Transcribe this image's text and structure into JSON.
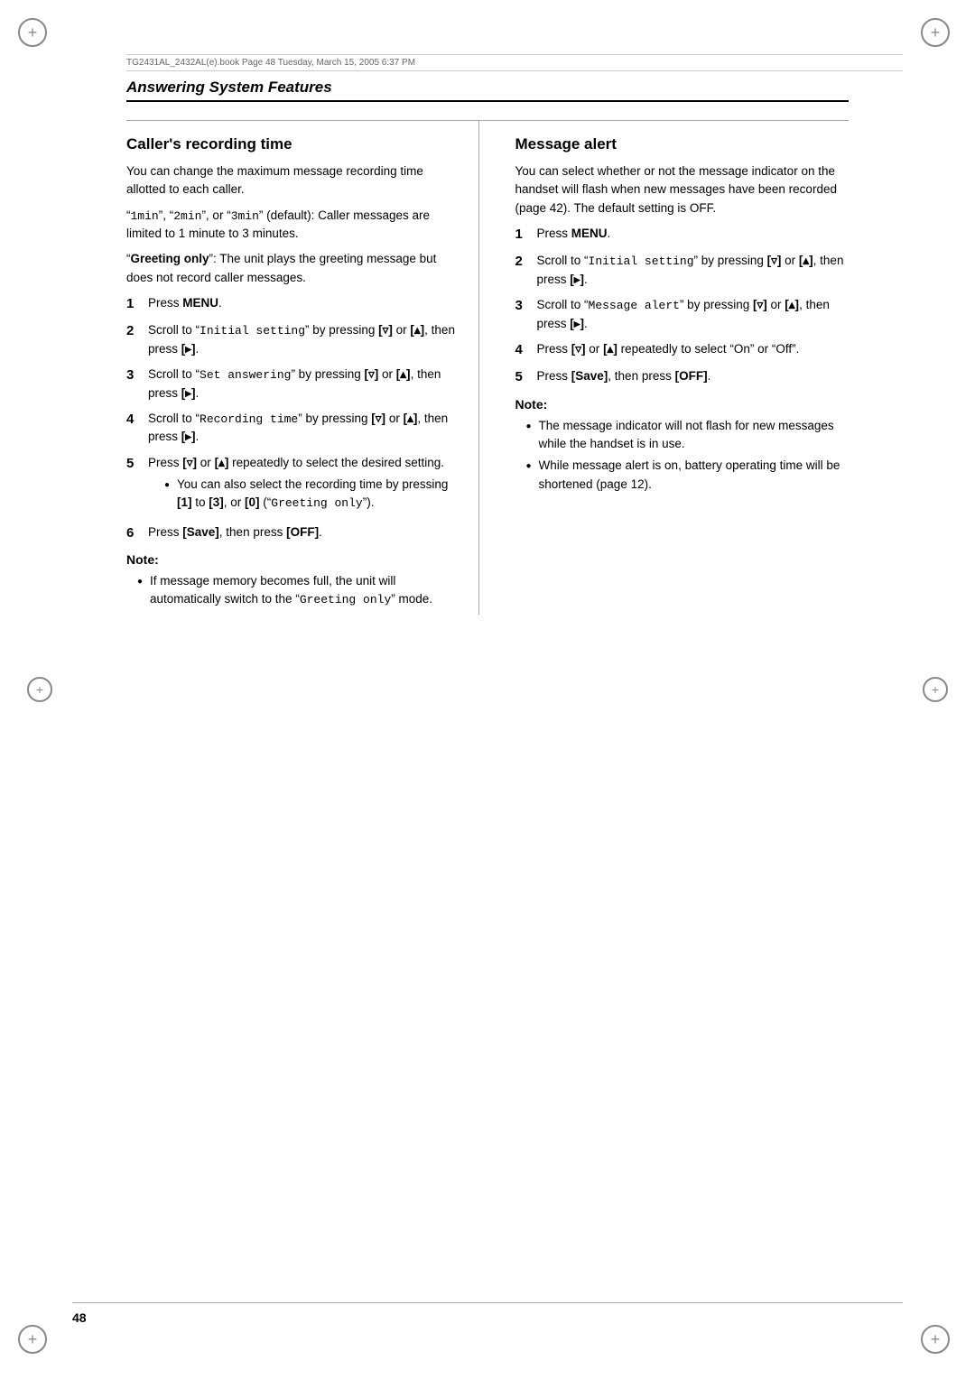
{
  "metadata": {
    "file_info": "TG2431AL_2432AL(e).book  Page 48  Tuesday, March 15, 2005  6:37 PM"
  },
  "section_title": "Answering System Features",
  "left_col": {
    "heading": "Caller's recording time",
    "intro_p1": "You can change the maximum message recording time allotted to each caller.",
    "intro_p2_prefix": "“",
    "intro_p2_1min": "1min",
    "intro_p2_mid": "”, “",
    "intro_p2_2min": "2min",
    "intro_p2_mid2": "”, or “",
    "intro_p2_3min": "3min",
    "intro_p2_suffix": "” (default): Caller messages are limited to 1 minute to 3 minutes.",
    "intro_p3_prefix": "“",
    "intro_p3_bold": "Greeting only",
    "intro_p3_suffix": "”: The unit plays the greeting message but does not record caller messages.",
    "steps": [
      {
        "num": "1",
        "text": "Press ",
        "bold": "MENU",
        "text_after": "."
      },
      {
        "num": "2",
        "text_before": "Scroll to “",
        "mono": "Initial setting",
        "text_mid": "” by pressing ",
        "key1": "[▿]",
        "text_or": " or ",
        "key2": "[▴]",
        "text_end": ", then press ",
        "key3": "[▸]",
        "period": "."
      },
      {
        "num": "3",
        "text_before": "Scroll to “",
        "mono": "Set answering",
        "text_mid": "” by pressing ",
        "key1": "[▿]",
        "text_or": " or ",
        "key2": "[▴]",
        "text_end": ", then press ",
        "key3": "[▸]",
        "period": "."
      },
      {
        "num": "4",
        "text_before": "Scroll to “",
        "mono": "Recording time",
        "text_mid": "” by pressing ",
        "key1": "[▿]",
        "text_or": " or ",
        "key2": "[▴]",
        "text_end": ", then press ",
        "key3": "[▸]",
        "period": "."
      },
      {
        "num": "5",
        "text": "Press ",
        "key1": "[▿]",
        "text_or": " or ",
        "key2": "[▴]",
        "text_end": " repeatedly to select the desired setting."
      }
    ],
    "step5_bullet": "You can also select the recording time by pressing [1] to [3], or [0] (“Greeting only”).",
    "step6_text_prefix": "Press ",
    "step6_bold": "Save",
    "step6_mid": "], then press [",
    "step6_bold2": "OFF",
    "step6_suffix": "].",
    "note_label": "Note:",
    "note_bullet": "If message memory becomes full, the unit will automatically switch to the “Greeting only” mode."
  },
  "right_col": {
    "heading": "Message alert",
    "intro": "You can select whether or not the message indicator on the handset will flash when new messages have been recorded (page 42). The default setting is OFF.",
    "steps": [
      {
        "num": "1",
        "text": "Press ",
        "bold": "MENU",
        "period": "."
      },
      {
        "num": "2",
        "text_before": "Scroll to “",
        "mono": "Initial setting",
        "text_mid": "” by pressing ",
        "key1": "[▿]",
        "text_or": " or ",
        "key2": "[▴]",
        "text_end": ", then press ",
        "key3": "[▸]",
        "period": "."
      },
      {
        "num": "3",
        "text_before": "Scroll to “",
        "mono": "Message alert",
        "text_mid": "” by pressing ",
        "key1": "[▿]",
        "text_or": " or ",
        "key2": "[▴]",
        "text_end": ", then press ",
        "key3": "[▸]",
        "period": "."
      },
      {
        "num": "4",
        "text": "Press ",
        "key1": "[▿]",
        "text_or": " or ",
        "key2": "[▴]",
        "text_end": " repeatedly to select “On” or “Off”."
      },
      {
        "num": "5",
        "text_prefix": "Press ",
        "bold": "Save",
        "text_mid": "], then press [",
        "bold2": "OFF",
        "text_suffix": "]."
      }
    ],
    "note_label": "Note:",
    "note_bullets": [
      "The message indicator will not flash for new messages while the handset is in use.",
      "While message alert is on, battery operating time will be shortened (page 12)."
    ]
  },
  "page_number": "48"
}
